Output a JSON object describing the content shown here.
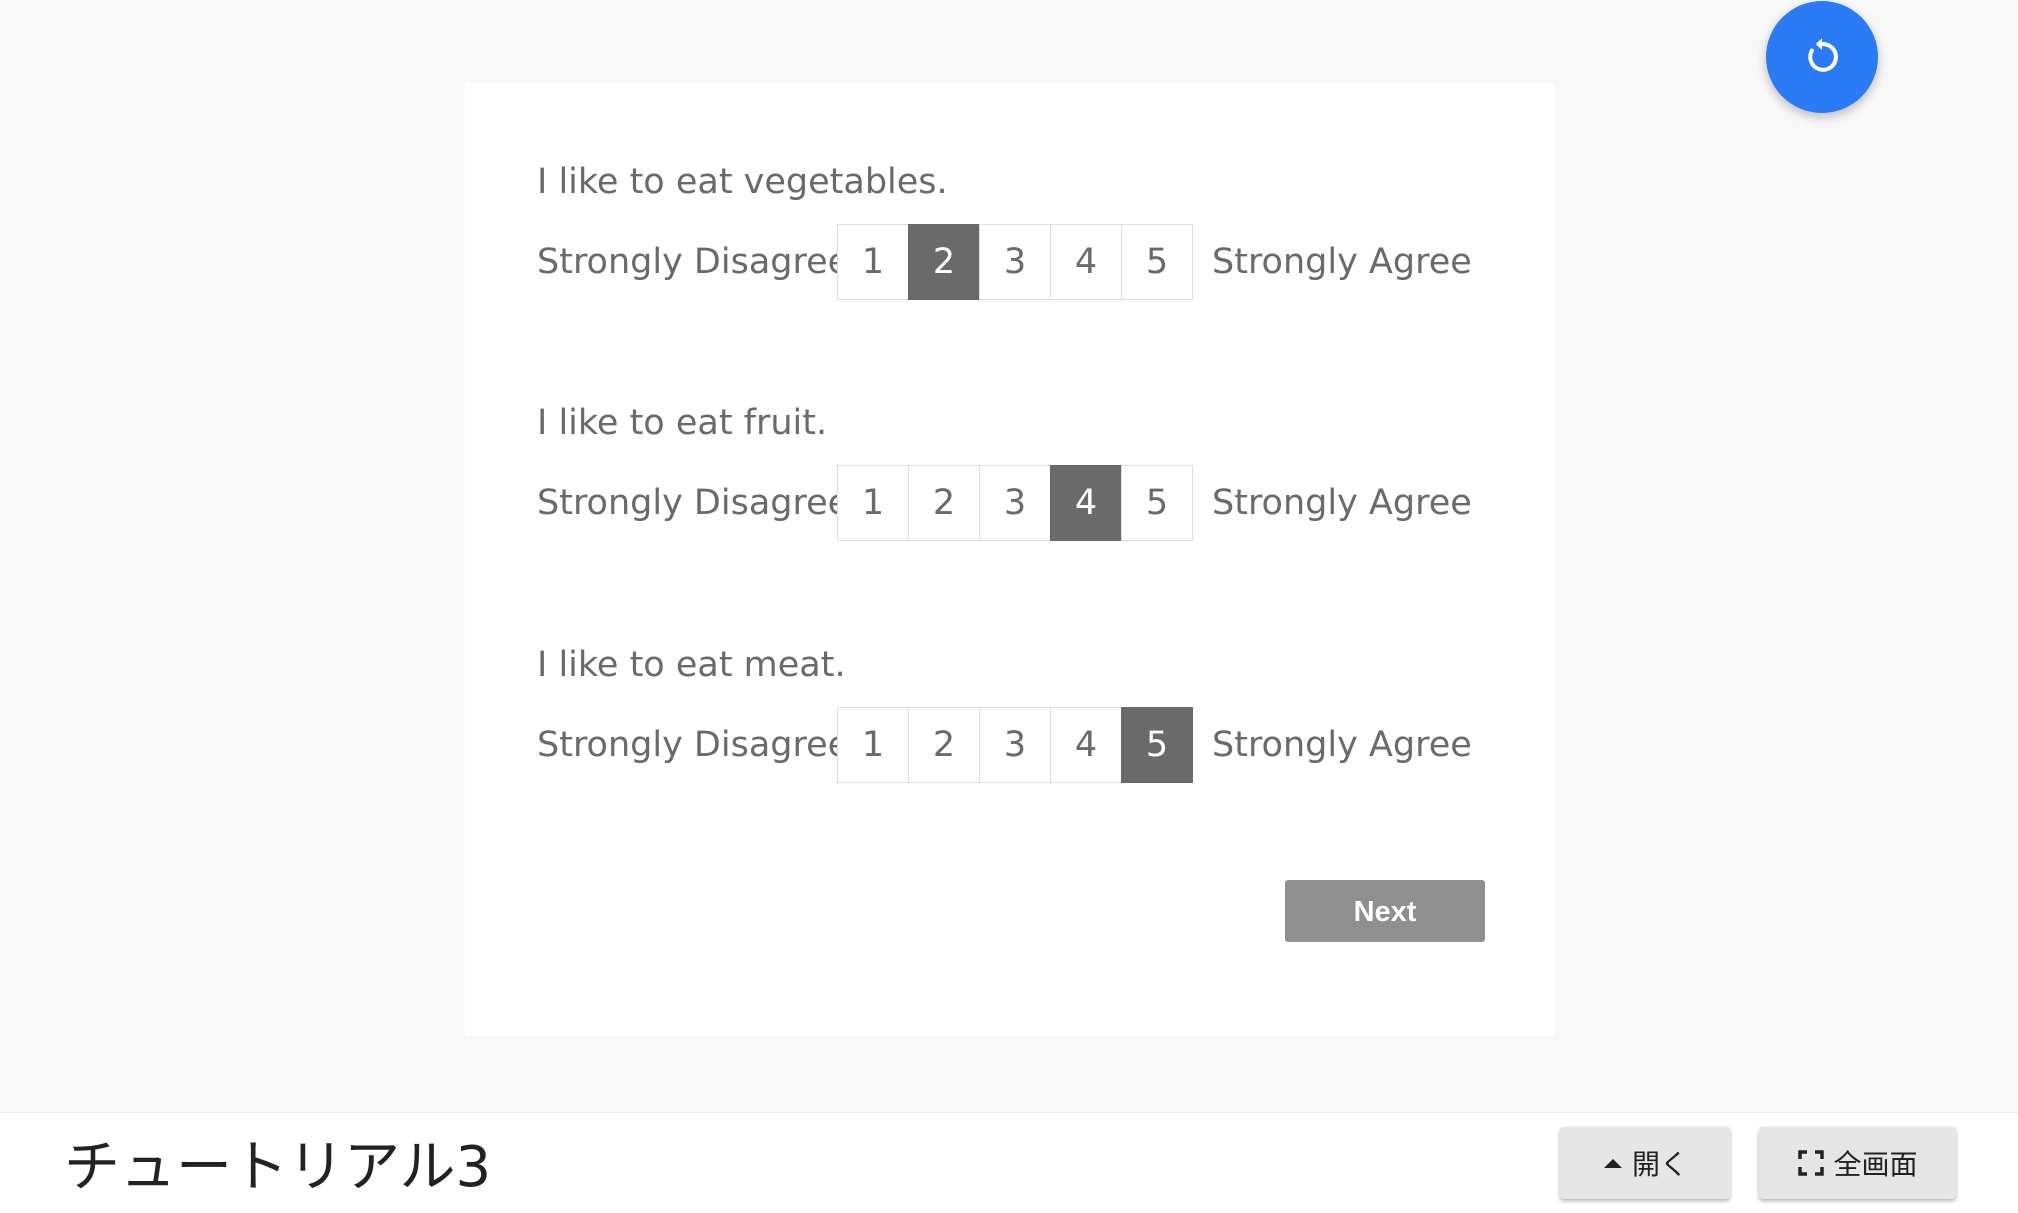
{
  "questions": [
    {
      "text": "I like to eat vegetables.",
      "left_label": "Strongly Disagree",
      "right_label": "Strongly Agree",
      "options": [
        "1",
        "2",
        "3",
        "4",
        "5"
      ],
      "selected": "2"
    },
    {
      "text": "I like to eat fruit.",
      "left_label": "Strongly Disagree",
      "right_label": "Strongly Agree",
      "options": [
        "1",
        "2",
        "3",
        "4",
        "5"
      ],
      "selected": "4"
    },
    {
      "text": "I like to eat meat.",
      "left_label": "Strongly Disagree",
      "right_label": "Strongly Agree",
      "options": [
        "1",
        "2",
        "3",
        "4",
        "5"
      ],
      "selected": "5"
    }
  ],
  "next_button": "Next",
  "fab": {
    "icon": "reload-icon",
    "color": "#2a7bf5"
  },
  "bottom_bar": {
    "title": "チュートリアル3",
    "open_button": "開く",
    "open_icon": "caret-up-icon",
    "fullscreen_button": "全画面",
    "fullscreen_icon": "fullscreen-icon"
  },
  "colors": {
    "selected_option": "#6a6a6a",
    "next_button": "#8f8f8f",
    "background": "#f8f8f8"
  }
}
